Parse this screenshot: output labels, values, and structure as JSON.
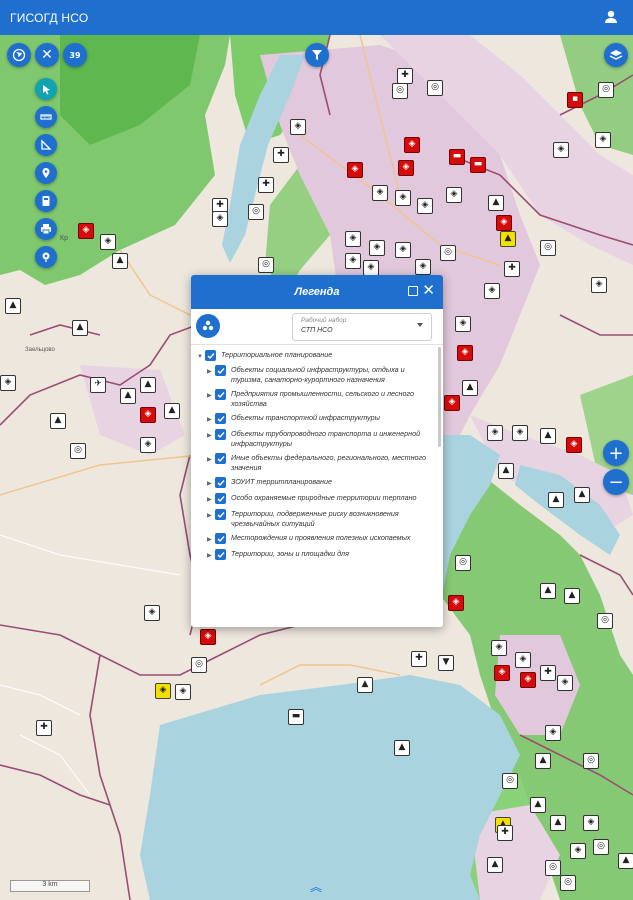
{
  "app": {
    "title": "ГИСОГД НСО"
  },
  "map_buttons": {
    "layers_count": "39",
    "zoom_in": "+",
    "zoom_out": "−"
  },
  "map_labels": {
    "kr": "Кр",
    "zh": "Заельцово"
  },
  "legend": {
    "title": "Легенда",
    "set_select": {
      "label": "Рабочий набор",
      "value": "СТП НСО"
    },
    "root": "Территориальное планирование",
    "items": [
      "Объекты социальной инфраструктуры, отдыха и туризма, санаторно-курортного назначения",
      "Предприятия промышленности, сельского и лесного хозяйства",
      "Объекты транспортной инфраструктуры",
      "Объекты трубопроводного транспорта и инженерной инфраструктуры",
      "Иные объекты федерального, регионального, местного значения",
      "ЗОУИТ территпланирование",
      "Особо охраняемые природные территории терплано",
      "Территории, подверженные риску возникновения чрезвычайных ситуаций",
      "Месторождения и проявления полезных ископаемых",
      "Территории, зоны и площадки для"
    ]
  },
  "scale": {
    "text": "3 km"
  },
  "colors": {
    "primary": "#1e6fce",
    "forest": "#6cc25a",
    "water": "#a9d3df",
    "urban": "#e2c8dc",
    "marker_red": "#d50c0c"
  }
}
